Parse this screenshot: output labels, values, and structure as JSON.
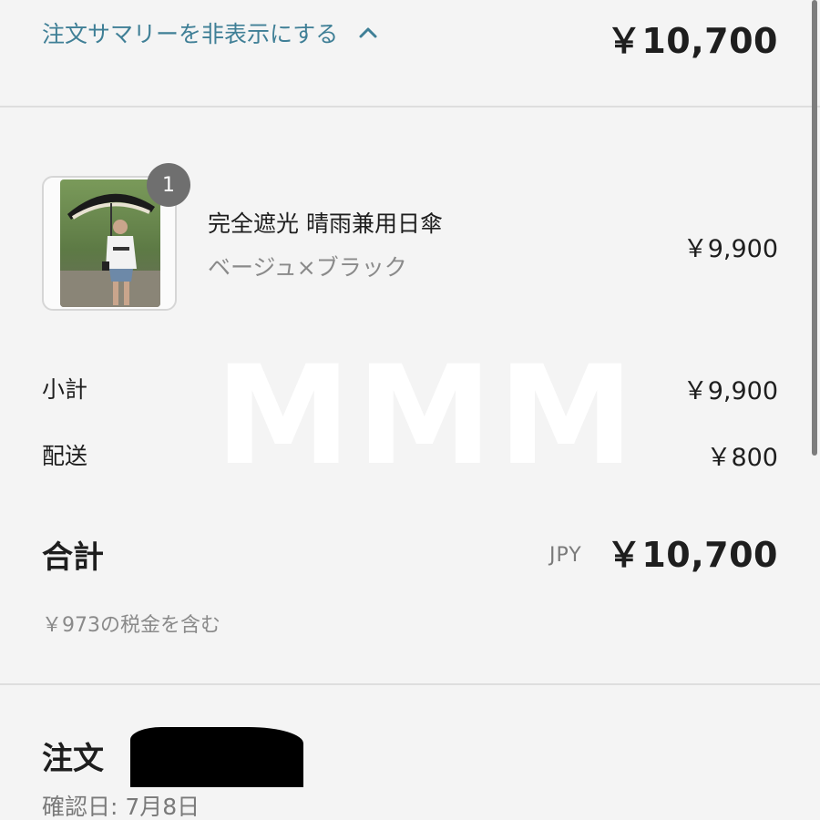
{
  "header": {
    "toggle_label": "注文サマリーを非表示にする",
    "total": "￥10,700"
  },
  "item": {
    "quantity": "1",
    "name": "完全遮光 晴雨兼用日傘",
    "variant": "ベージュ×ブラック",
    "price": "￥9,900"
  },
  "costs": {
    "subtotal_label": "小計",
    "subtotal_value": "￥9,900",
    "shipping_label": "配送",
    "shipping_value": "￥800"
  },
  "total": {
    "label": "合計",
    "currency": "JPY",
    "value": "￥10,700",
    "tax_note": "￥973の税金を含む"
  },
  "order": {
    "title": "注文",
    "confirmed": "確認日: 7月8日"
  },
  "watermark": "MMM",
  "colors": {
    "link": "#3f7f96",
    "background": "#f4f4f4",
    "badge": "#6f6f6f"
  },
  "icons": {
    "toggle": "chevron-up-icon"
  }
}
